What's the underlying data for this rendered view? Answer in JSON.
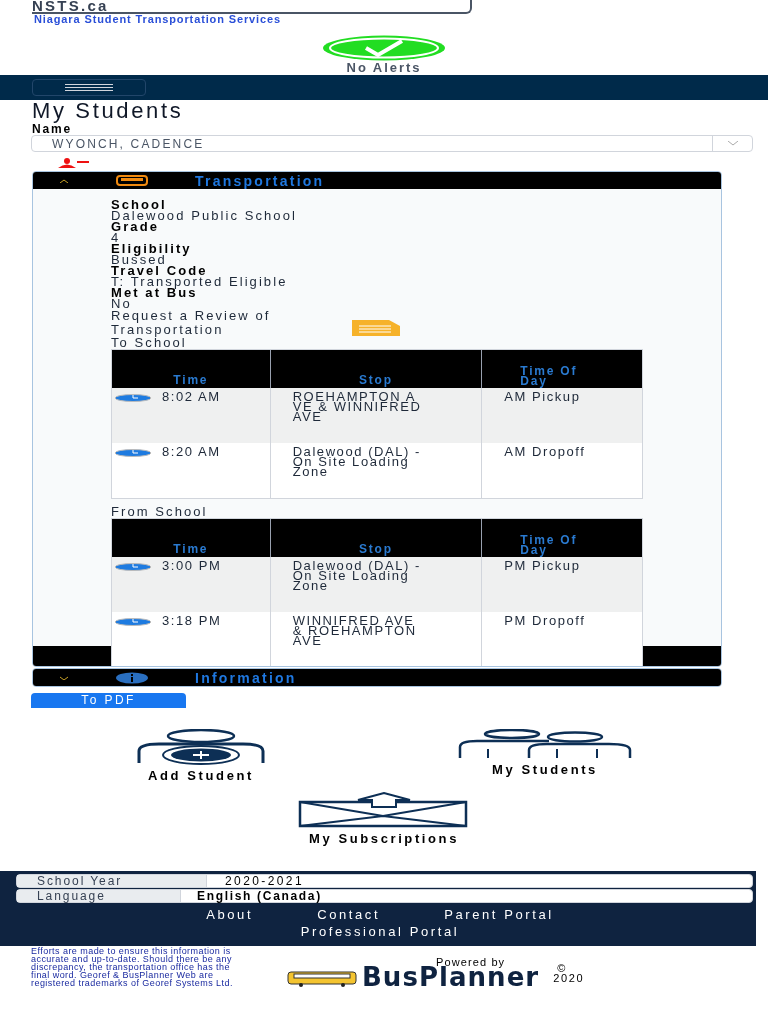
{
  "header": {
    "logo_title": "NSTS.ca",
    "logo_subtitle": "Niagara Student Transportation Services",
    "alert": "No Alerts"
  },
  "page_title": "My Students",
  "student_field": {
    "label": "Name",
    "value": "WYONCH, CADENCE"
  },
  "panels": [
    {
      "title": "Transportation",
      "kind": "transportation",
      "expanded": true
    },
    {
      "title": "Information",
      "kind": "information",
      "expanded": false
    }
  ],
  "details": [
    {
      "label": "School",
      "value": "Dalewood Public School"
    },
    {
      "label": "Grade",
      "value": "4"
    },
    {
      "label": "Eligibility",
      "value": "Bussed"
    },
    {
      "label": "Travel Code",
      "value": "T: Transported Eligible"
    },
    {
      "label": "Met at Bus",
      "value": "No"
    }
  ],
  "review_link": "Request a Review of Transportation",
  "trips": [
    {
      "title": "To School",
      "columns": [
        "Time",
        "Stop",
        "Time Of Day"
      ],
      "rows": [
        {
          "time": "8:02 AM",
          "stop": "ROEHAMPTON AVE & WINNIFRED AVE",
          "time_of_day": "AM Pickup"
        },
        {
          "time": "8:20 AM",
          "stop": "Dalewood (DAL) - On Site Loading Zone",
          "time_of_day": "AM Dropoff"
        }
      ]
    },
    {
      "title": "From School",
      "columns": [
        "Time",
        "Stop",
        "Time Of Day"
      ],
      "rows": [
        {
          "time": "3:00 PM",
          "stop": "Dalewood (DAL) - On Site Loading Zone",
          "time_of_day": "PM Pickup"
        },
        {
          "time": "3:18 PM",
          "stop": "WINNIFRED AVE & ROEHAMPTON AVE",
          "time_of_day": "PM Dropoff"
        }
      ]
    }
  ],
  "pdf_button": "To PDF",
  "shortcuts": [
    {
      "label": "Add Student",
      "kind": "add"
    },
    {
      "label": "My Students",
      "kind": "group"
    },
    {
      "label": "My Subscriptions",
      "kind": "mail"
    }
  ],
  "footer": {
    "fields": [
      {
        "label": "School Year",
        "value": "2020-2021",
        "kind": "text"
      },
      {
        "label": "Language",
        "value": "English (Canada)",
        "kind": "select"
      }
    ],
    "links": [
      "About",
      "Contact",
      "Parent Portal",
      "Professional Portal"
    ],
    "disclaimer": "Efforts are made to ensure this information is accurate and up-to-date. Should there be any discrepancy, the transportation office has the final word. Georef & BusPlanner Web are registered trademarks of Georef Systems Ltd.",
    "powered_by": "Powered by",
    "brand": "BusPlanner",
    "copyright": "©",
    "year": "2020"
  }
}
